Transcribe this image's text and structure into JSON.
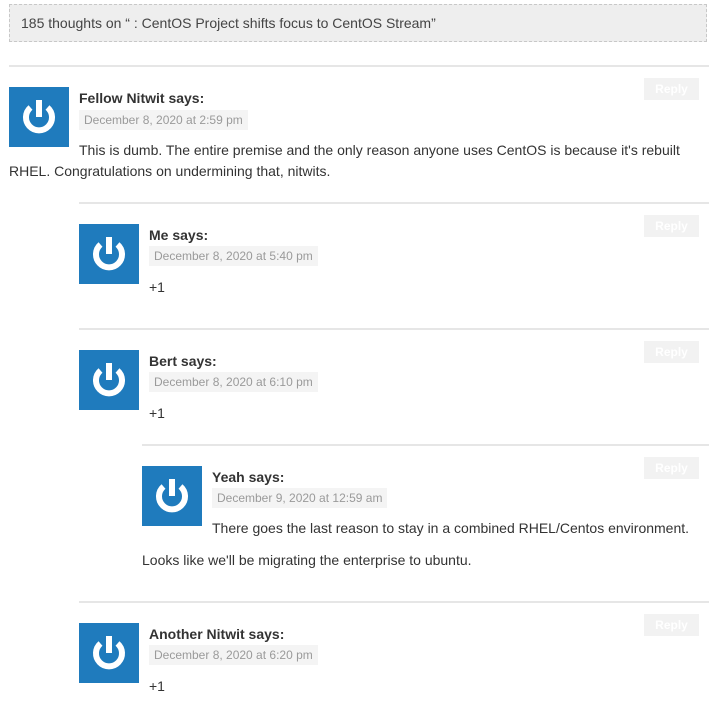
{
  "header": {
    "thread_title": "185 thoughts on “ : CentOS Project shifts focus to CentOS Stream”"
  },
  "colors": {
    "avatar_bg": "#1f7bbd",
    "date_badge_bg": "#f4f4f4",
    "header_bg": "#eeeeee"
  },
  "comments": [
    {
      "author": "Fellow Nitwit",
      "says": "says:",
      "date": "December 8, 2020 at 2:59 pm",
      "reply_label": "Reply",
      "text": "This is dumb. The entire premise and the only reason anyone uses CentOS is because it's rebuilt RHEL. Congratulations on undermining that, nitwits.",
      "avatar_icon": "gravatar-power-icon"
    },
    {
      "author": "Me",
      "says": "says:",
      "date": "December 8, 2020 at 5:40 pm",
      "reply_label": "Reply",
      "text": "+1",
      "avatar_icon": "gravatar-power-icon"
    },
    {
      "author": "Bert",
      "says": "says:",
      "date": "December 8, 2020 at 6:10 pm",
      "reply_label": "Reply",
      "text": "+1",
      "avatar_icon": "gravatar-power-icon"
    },
    {
      "author": "Yeah",
      "says": "says:",
      "date": "December 9, 2020 at 12:59 am",
      "reply_label": "Reply",
      "text": "There goes the last reason to stay in a combined RHEL/Centos environment.",
      "text2": "Looks like we'll be migrating the enterprise to ubuntu.",
      "avatar_icon": "gravatar-power-icon"
    },
    {
      "author": "Another Nitwit",
      "says": "says:",
      "date": "December 8, 2020 at 6:20 pm",
      "reply_label": "Reply",
      "text": "+1",
      "avatar_icon": "gravatar-power-icon"
    }
  ]
}
